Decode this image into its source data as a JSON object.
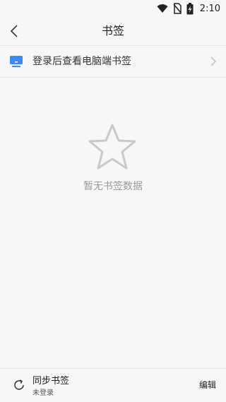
{
  "status_bar": {
    "time": "2:10",
    "icons": [
      "wifi-icon",
      "no-sim-icon",
      "battery-charging-icon"
    ]
  },
  "header": {
    "title": "书签",
    "back_icon": "chevron-left-icon"
  },
  "login_row": {
    "label": "登录后查看电脑端书签",
    "icon": "computer-icon",
    "icon_color": "#3d8bf2",
    "arrow_icon": "chevron-right-icon"
  },
  "empty_state": {
    "icon": "star-outline-icon",
    "text": "暂无书签数据"
  },
  "bottom_bar": {
    "sync_icon": "sync-icon",
    "sync_title": "同步书签",
    "sync_status": "未登录",
    "edit_label": "编辑"
  },
  "colors": {
    "background": "#f7f7f7",
    "divider": "#e6e6e6",
    "accent": "#3d8bf2",
    "muted_text": "#9a9a9a"
  }
}
